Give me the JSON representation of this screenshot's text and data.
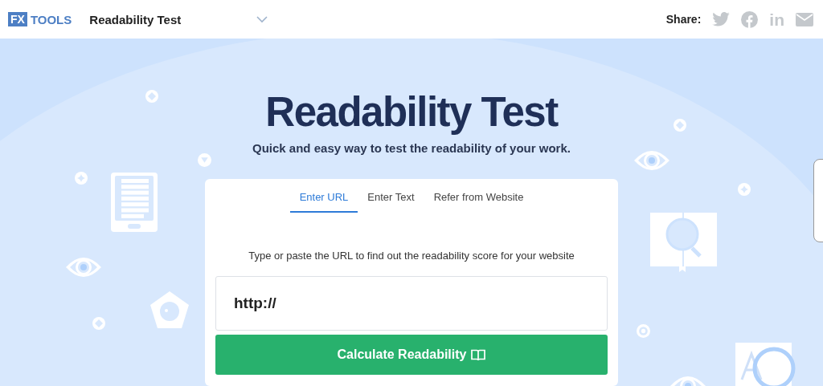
{
  "header": {
    "logo": {
      "mark": "FX",
      "text": "TOOLS"
    },
    "tool_select": {
      "value": "Readability Test"
    },
    "share": {
      "label": "Share:",
      "network_glyph": "in"
    }
  },
  "hero": {
    "title": "Readability Test",
    "subtitle": "Quick and easy way to test the readability of your work."
  },
  "card": {
    "tabs": [
      {
        "label": "Enter URL",
        "selected": true
      },
      {
        "label": "Enter Text",
        "selected": false
      },
      {
        "label": "Refer from Website",
        "selected": false
      }
    ],
    "instruction": "Type or paste the URL to find out the readability score for your website",
    "url_field": {
      "value": "http://"
    },
    "submit_button": {
      "label": "Calculate Readability"
    }
  }
}
